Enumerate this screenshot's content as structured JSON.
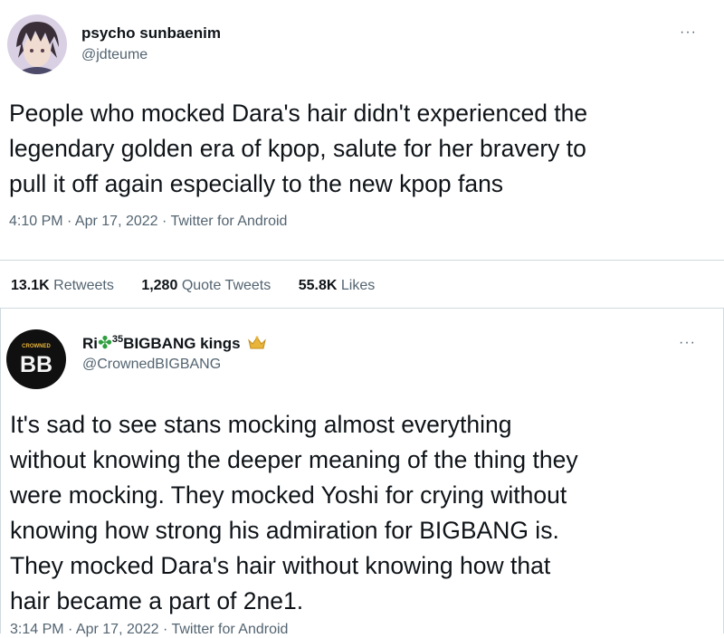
{
  "tweets": [
    {
      "display_name": "psycho sunbaenim",
      "handle": "@jdteume",
      "more": "···",
      "text": "People who mocked Dara's hair didn't experienced the\nlegendary golden era of kpop, salute for her bravery to\npull it off again especially to the new kpop fans",
      "meta": "4:10 PM · Apr 17, 2022 · Twitter for Android",
      "stats": {
        "retweets_count": "13.1K",
        "retweets_label": "Retweets",
        "quotes_count": "1,280",
        "quotes_label": "Quote Tweets",
        "likes_count": "55.8K",
        "likes_label": "Likes"
      }
    },
    {
      "display_name_prefix": "Ri",
      "display_name_sup": "35",
      "display_name_suffix": "BIGBANG kings",
      "handle": "@CrownedBIGBANG",
      "avatar_text": "BB",
      "avatar_small_text": "CROWNED",
      "more": "···",
      "text": "It's sad to see stans mocking almost everything\nwithout knowing the deeper meaning of the thing they\nwere mocking. They mocked Yoshi for crying without\nknowing how strong his admiration for BIGBANG is.\nThey mocked Dara's hair without knowing how that\nhair became a part of 2ne1.",
      "meta": "3:14 PM · Apr 17, 2022 · Twitter for Android"
    }
  ],
  "colors": {
    "text": "#0f1419",
    "secondary": "#536471",
    "divider": "#cfd9de",
    "clover": "#2e9e3e",
    "crown": "#e8b53a"
  },
  "icons": [
    "clover-icon",
    "crown-icon",
    "more-icon"
  ]
}
